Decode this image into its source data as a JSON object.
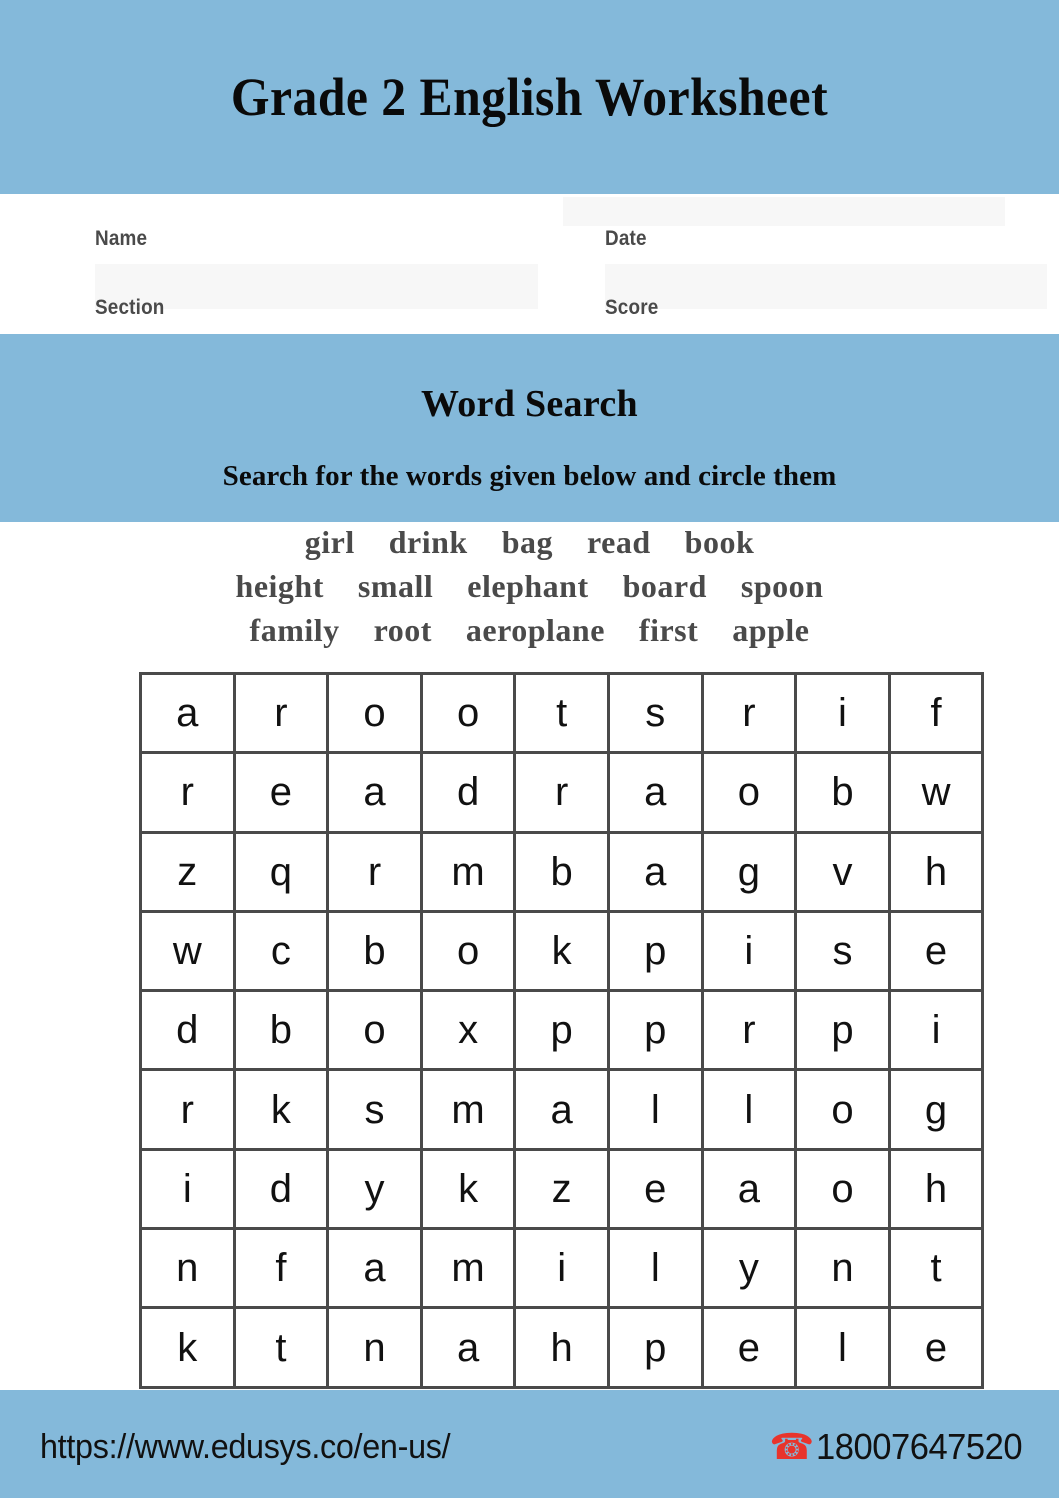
{
  "header": {
    "title": "Grade 2 English Worksheet",
    "band_color": "#84b9da"
  },
  "info_fields": {
    "name_label": "Name",
    "date_label": "Date",
    "section_label": "Section",
    "score_label": "Score",
    "name_value": "",
    "date_value": "",
    "section_value": "",
    "score_value": "",
    "field_bg": "#f7f7f7"
  },
  "activity": {
    "title": "Word Search",
    "instruction": "Search for the words given below and circle them"
  },
  "word_list": {
    "rows": [
      [
        "girl",
        "drink",
        "bag",
        "read",
        "book"
      ],
      [
        "height",
        "small",
        "elephant",
        "board",
        "spoon"
      ],
      [
        "family",
        "root",
        "aeroplane",
        "first",
        "apple"
      ]
    ],
    "all_words": [
      "girl",
      "drink",
      "bag",
      "read",
      "book",
      "height",
      "small",
      "elephant",
      "board",
      "spoon",
      "family",
      "root",
      "aeroplane",
      "first",
      "apple"
    ],
    "text_color": "#4a4a4a"
  },
  "grid": {
    "rows": 9,
    "cols": 9,
    "border_color": "#4a4a4a",
    "letters": [
      [
        "a",
        "r",
        "o",
        "o",
        "t",
        "s",
        "r",
        "i",
        "f"
      ],
      [
        "r",
        "e",
        "a",
        "d",
        "r",
        "a",
        "o",
        "b",
        "w"
      ],
      [
        "z",
        "q",
        "r",
        "m",
        "b",
        "a",
        "g",
        "v",
        "h"
      ],
      [
        "w",
        "c",
        "b",
        "o",
        "k",
        "p",
        "i",
        "s",
        "e"
      ],
      [
        "d",
        "b",
        "o",
        "x",
        "p",
        "p",
        "r",
        "p",
        "i"
      ],
      [
        "r",
        "k",
        "s",
        "m",
        "a",
        "l",
        "l",
        "o",
        "g"
      ],
      [
        "i",
        "d",
        "y",
        "k",
        "z",
        "e",
        "a",
        "o",
        "h"
      ],
      [
        "n",
        "f",
        "a",
        "m",
        "i",
        "l",
        "y",
        "n",
        "t"
      ],
      [
        "k",
        "t",
        "n",
        "a",
        "h",
        "p",
        "e",
        "l",
        "e"
      ]
    ]
  },
  "footer": {
    "url": "https://www.edusys.co/en-us/",
    "phone_icon": "telephone-icon",
    "phone_glyph": "☎",
    "phone_number": "18007647520",
    "phone_icon_color": "#e8342c"
  }
}
